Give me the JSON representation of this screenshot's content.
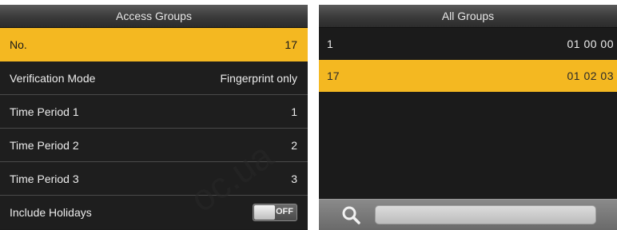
{
  "left": {
    "title": "Access Groups",
    "rows": [
      {
        "label": "No.",
        "value": "17"
      },
      {
        "label": "Verification Mode",
        "value": "Fingerprint only"
      },
      {
        "label": "Time Period 1",
        "value": "1"
      },
      {
        "label": "Time Period 2",
        "value": "2"
      },
      {
        "label": "Time Period 3",
        "value": "3"
      }
    ],
    "holidays": {
      "label": "Include Holidays",
      "toggle_state": "OFF"
    }
  },
  "right": {
    "title": "All Groups",
    "items": [
      {
        "id": "1",
        "code": "01 00 00"
      },
      {
        "id": "17",
        "code": "01 02 03"
      }
    ]
  },
  "watermark": "oc.ua",
  "colors": {
    "highlight": "#f4b821",
    "background": "#1b1b1b"
  },
  "icons": {
    "search": "search-icon"
  }
}
